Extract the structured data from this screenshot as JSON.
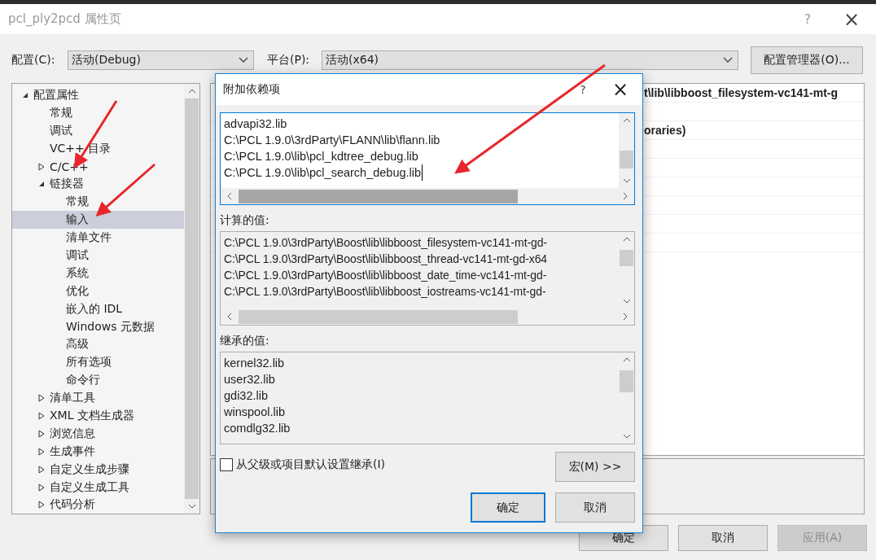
{
  "window": {
    "title": "pcl_ply2pcd 属性页",
    "help": "?",
    "close": "×"
  },
  "config": {
    "label": "配置(C):",
    "value": "活动(Debug)"
  },
  "platform": {
    "label": "平台(P):",
    "value": "活动(x64)"
  },
  "config_manager_button": "配置管理器(O)...",
  "tree": [
    {
      "label": "配置属性",
      "kind": "group",
      "expanded": true,
      "selected": false,
      "children": [
        {
          "label": "常规",
          "kind": "leaf",
          "selected": false
        },
        {
          "label": "调试",
          "kind": "leaf",
          "selected": false
        },
        {
          "label": "VC++ 目录",
          "kind": "leaf",
          "selected": false
        },
        {
          "label": "C/C++",
          "kind": "group",
          "expanded": false,
          "selected": false
        },
        {
          "label": "链接器",
          "kind": "group",
          "expanded": true,
          "selected": false,
          "children": [
            {
              "label": "常规",
              "kind": "leaf",
              "selected": false
            },
            {
              "label": "输入",
              "kind": "leaf",
              "selected": true
            },
            {
              "label": "清单文件",
              "kind": "leaf",
              "selected": false
            },
            {
              "label": "调试",
              "kind": "leaf",
              "selected": false
            },
            {
              "label": "系统",
              "kind": "leaf",
              "selected": false
            },
            {
              "label": "优化",
              "kind": "leaf",
              "selected": false
            },
            {
              "label": "嵌入的 IDL",
              "kind": "leaf",
              "selected": false
            },
            {
              "label": "Windows 元数据",
              "kind": "leaf",
              "selected": false
            },
            {
              "label": "高级",
              "kind": "leaf",
              "selected": false
            },
            {
              "label": "所有选项",
              "kind": "leaf",
              "selected": false
            },
            {
              "label": "命令行",
              "kind": "leaf",
              "selected": false
            }
          ]
        },
        {
          "label": "清单工具",
          "kind": "group",
          "expanded": false,
          "selected": false
        },
        {
          "label": "XML 文档生成器",
          "kind": "group",
          "expanded": false,
          "selected": false
        },
        {
          "label": "浏览信息",
          "kind": "group",
          "expanded": false,
          "selected": false
        },
        {
          "label": "生成事件",
          "kind": "group",
          "expanded": false,
          "selected": false
        },
        {
          "label": "自定义生成步骤",
          "kind": "group",
          "expanded": false,
          "selected": false
        },
        {
          "label": "自定义生成工具",
          "kind": "group",
          "expanded": false,
          "selected": false
        },
        {
          "label": "代码分析",
          "kind": "group",
          "expanded": false,
          "selected": false
        }
      ]
    }
  ],
  "property_grid": {
    "rows": [
      "t\\lib\\libboost_filesystem-vc141-mt-g",
      "",
      "oraries)",
      "",
      "",
      "",
      "",
      "",
      ""
    ]
  },
  "buttons": [
    {
      "label": "确定",
      "disabled": false
    },
    {
      "label": "取消",
      "disabled": false
    },
    {
      "label": "应用(A)",
      "disabled": true
    }
  ],
  "modal": {
    "title": "附加依赖项",
    "help": "?",
    "close": "×",
    "edit_lines": [
      "advapi32.lib",
      "C:\\PCL 1.9.0\\3rdParty\\FLANN\\lib\\flann.lib",
      "C:\\PCL 1.9.0\\lib\\pcl_kdtree_debug.lib",
      "C:\\PCL 1.9.0\\lib\\pcl_search_debug.lib"
    ],
    "computed_label": "计算的值:",
    "computed_lines": [
      "C:\\PCL 1.9.0\\3rdParty\\Boost\\lib\\libboost_filesystem-vc141-mt-gd-",
      "C:\\PCL 1.9.0\\3rdParty\\Boost\\lib\\libboost_thread-vc141-mt-gd-x64",
      "C:\\PCL 1.9.0\\3rdParty\\Boost\\lib\\libboost_date_time-vc141-mt-gd-",
      "C:\\PCL 1.9.0\\3rdParty\\Boost\\lib\\libboost_iostreams-vc141-mt-gd-"
    ],
    "inherited_label": "继承的值:",
    "inherited_lines": [
      "kernel32.lib",
      "user32.lib",
      "gdi32.lib",
      "winspool.lib",
      "comdlg32.lib"
    ],
    "inherit_checkbox": {
      "label": "从父级或项目默认设置继承(I)",
      "checked": false
    },
    "macro_button": "宏(M) >>",
    "ok_button": "确定",
    "cancel_button": "取消"
  }
}
